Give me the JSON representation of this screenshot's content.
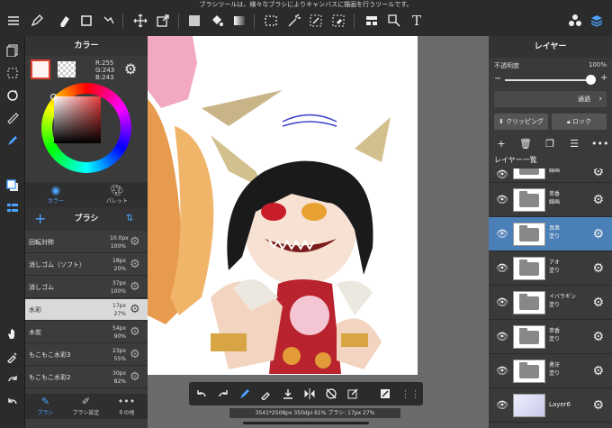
{
  "app": {
    "tip": "ブラシツールは、様々なブラシによりキャンバスに描画を行うツールです。"
  },
  "toolbar": {
    "icons": [
      "menu-icon",
      "eraser-icon",
      "rectangle-icon",
      "transform-icon",
      "move-icon",
      "export-icon",
      "fill-color-icon",
      "bucket-icon",
      "gradient-icon",
      "selection-rect-icon",
      "magic-wand-icon",
      "select-pen-icon",
      "select-eraser-icon",
      "layout-icon",
      "lasso-select-icon",
      "text-icon",
      "assets-icon",
      "layers-icon"
    ],
    "text_tool": "T"
  },
  "color_panel": {
    "title": "カラー",
    "r": "R:255",
    "g": "G:243",
    "b": "B:243",
    "main_color": "#fff3f3",
    "tab_color": "カラー",
    "tab_palette": "パレット"
  },
  "brush_panel": {
    "title": "ブラシ",
    "brushes": [
      {
        "name": "回転対称",
        "size": "10.0px",
        "opacity": "100%"
      },
      {
        "name": "消しゴム（ソフト）",
        "size": "18px",
        "opacity": "20%"
      },
      {
        "name": "消しゴム",
        "size": "37px",
        "opacity": "100%"
      },
      {
        "name": "水彩",
        "size": "17px",
        "opacity": "27%",
        "selected": true
      },
      {
        "name": "木炭",
        "size": "54px",
        "opacity": "90%"
      },
      {
        "name": "もこもこ水彩3",
        "size": "23px",
        "opacity": "55%"
      },
      {
        "name": "もこもこ水彩2",
        "size": "30px",
        "opacity": "82%"
      }
    ],
    "tabs": [
      "ブラシ",
      "ブラシ設定",
      "その他"
    ]
  },
  "status": "3541*2508px 350dpi 61% ブラシ: 17px 27%",
  "layer_panel": {
    "title": "レイヤー",
    "opacity_label": "不透明度",
    "opacity_value": "100%",
    "opacity": 1.0,
    "blend_mode": "通過",
    "clipping": "クリッピング",
    "lock": "ロック",
    "folder_header": "レイヤー一覧",
    "layers": [
      {
        "name": "線画",
        "type": "folder"
      },
      {
        "name": "萃香\n線画",
        "type": "folder"
      },
      {
        "name": "真衆\n塗り",
        "type": "folder",
        "selected": true
      },
      {
        "name": "アオ\n塗り",
        "type": "folder"
      },
      {
        "name": "イバラギン\n塗り",
        "type": "folder"
      },
      {
        "name": "萃香\n塗り",
        "type": "folder"
      },
      {
        "name": "勇牙\n塗り",
        "type": "folder"
      },
      {
        "name": "Layer6",
        "type": "image"
      }
    ]
  },
  "colors": {
    "accent": "#4aa3ff",
    "selected_layer": "#4a7fb8",
    "panel": "#3a3a3a",
    "toolbar": "#2b2b2b"
  }
}
